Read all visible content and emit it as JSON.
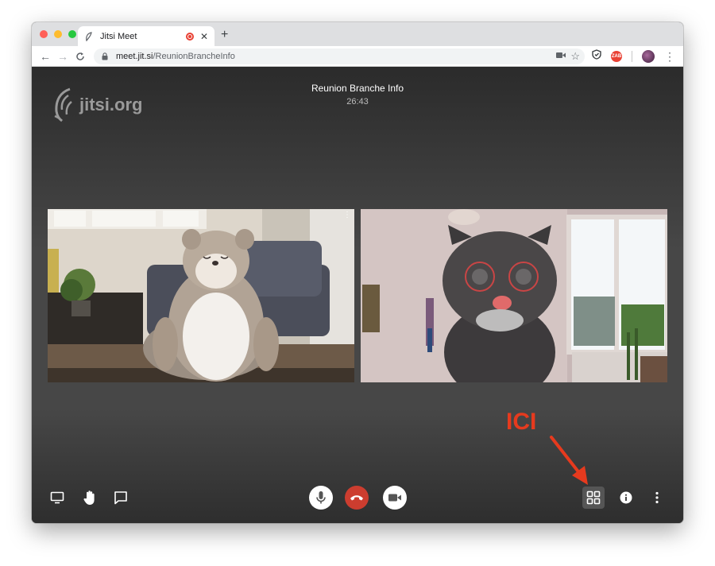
{
  "browser": {
    "tab": {
      "title": "Jitsi Meet"
    },
    "url": {
      "host": "meet.jit.si",
      "path": "/ReunionBrancheInfo"
    },
    "extension_badge": "ZAB",
    "colors": {
      "close": "#ff5f57",
      "minimize": "#febc2e",
      "zoom": "#28c840"
    }
  },
  "meeting": {
    "logo_text": "jitsi.org",
    "title": "Reunion Branche Info",
    "timer": "26:43"
  },
  "annotation": {
    "label": "ICI",
    "color": "#e63a1e"
  },
  "toolbar_icons": {
    "left": [
      "screen-share-icon",
      "raise-hand-icon",
      "chat-icon"
    ],
    "center": [
      "microphone-icon",
      "hangup-icon",
      "camera-icon"
    ],
    "right": [
      "tile-view-icon",
      "info-icon",
      "more-options-icon"
    ]
  }
}
